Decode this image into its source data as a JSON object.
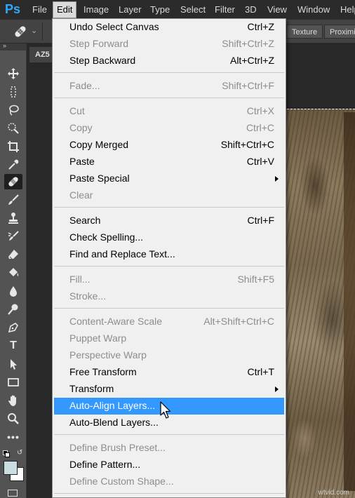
{
  "app": {
    "logo": "Ps"
  },
  "menubar": {
    "items": [
      "File",
      "Edit",
      "Image",
      "Layer",
      "Type",
      "Select",
      "Filter",
      "3D",
      "View",
      "Window",
      "Help"
    ],
    "active": "Edit"
  },
  "options": {
    "tool_icon": "healing-brush-icon",
    "buttons": [
      "Texture",
      "Proximit"
    ]
  },
  "document": {
    "tab_label": "AZ5"
  },
  "edit_menu": {
    "items": [
      {
        "label": "Undo Select Canvas",
        "shortcut": "Ctrl+Z",
        "enabled": true
      },
      {
        "label": "Step Forward",
        "shortcut": "Shift+Ctrl+Z",
        "enabled": false
      },
      {
        "label": "Step Backward",
        "shortcut": "Alt+Ctrl+Z",
        "enabled": true
      },
      {
        "label": "Fade...",
        "shortcut": "Shift+Ctrl+F",
        "enabled": false
      },
      {
        "label": "Cut",
        "shortcut": "Ctrl+X",
        "enabled": false
      },
      {
        "label": "Copy",
        "shortcut": "Ctrl+C",
        "enabled": false
      },
      {
        "label": "Copy Merged",
        "shortcut": "Shift+Ctrl+C",
        "enabled": true
      },
      {
        "label": "Paste",
        "shortcut": "Ctrl+V",
        "enabled": true
      },
      {
        "label": "Paste Special",
        "shortcut": "",
        "enabled": true,
        "submenu": true
      },
      {
        "label": "Clear",
        "shortcut": "",
        "enabled": false
      },
      {
        "label": "Search",
        "shortcut": "Ctrl+F",
        "enabled": true
      },
      {
        "label": "Check Spelling...",
        "shortcut": "",
        "enabled": true
      },
      {
        "label": "Find and Replace Text...",
        "shortcut": "",
        "enabled": true
      },
      {
        "label": "Fill...",
        "shortcut": "Shift+F5",
        "enabled": false
      },
      {
        "label": "Stroke...",
        "shortcut": "",
        "enabled": false
      },
      {
        "label": "Content-Aware Scale",
        "shortcut": "Alt+Shift+Ctrl+C",
        "enabled": false
      },
      {
        "label": "Puppet Warp",
        "shortcut": "",
        "enabled": false
      },
      {
        "label": "Perspective Warp",
        "shortcut": "",
        "enabled": false
      },
      {
        "label": "Free Transform",
        "shortcut": "Ctrl+T",
        "enabled": true
      },
      {
        "label": "Transform",
        "shortcut": "",
        "enabled": true,
        "submenu": true
      },
      {
        "label": "Auto-Align Layers...",
        "shortcut": "",
        "enabled": true,
        "highlighted": true
      },
      {
        "label": "Auto-Blend Layers...",
        "shortcut": "",
        "enabled": true
      },
      {
        "label": "Define Brush Preset...",
        "shortcut": "",
        "enabled": false
      },
      {
        "label": "Define Pattern...",
        "shortcut": "",
        "enabled": true
      },
      {
        "label": "Define Custom Shape...",
        "shortcut": "",
        "enabled": false
      }
    ]
  },
  "tools": [
    "move-icon",
    "marquee-icon",
    "lasso-icon",
    "quick-selection-icon",
    "crop-icon",
    "eyedropper-icon",
    "healing-brush-icon",
    "brush-icon",
    "clone-stamp-icon",
    "history-brush-icon",
    "eraser-icon",
    "paint-bucket-icon",
    "blur-icon",
    "dodge-icon",
    "pen-icon",
    "type-icon",
    "path-selection-icon",
    "rectangle-icon",
    "hand-icon",
    "zoom-icon",
    "more-icon"
  ],
  "colors": {
    "menu_highlight": "#3399ff",
    "menu_bg": "#f0f0f0",
    "disabled_text": "#8d8d8d",
    "ps_blue": "#31a8ff",
    "foreground_color": "#c9dde3",
    "background_color": "#ffffff"
  },
  "watermark": "wtvid.com"
}
